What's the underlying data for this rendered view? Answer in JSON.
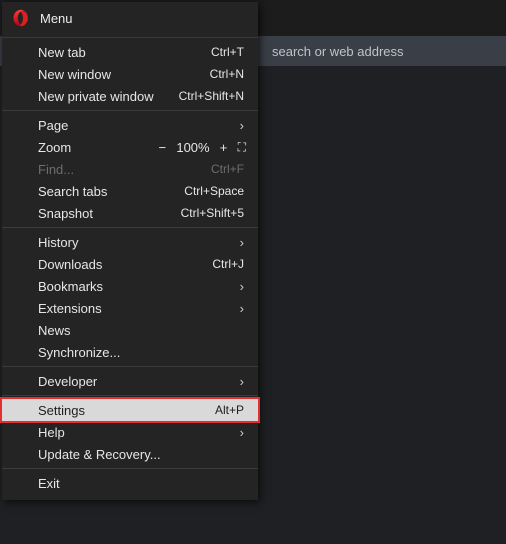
{
  "background": {
    "address_placeholder": "search or web address"
  },
  "menu": {
    "title": "Menu",
    "groups": [
      [
        {
          "label": "New tab",
          "shortcut": "Ctrl+T"
        },
        {
          "label": "New window",
          "shortcut": "Ctrl+N"
        },
        {
          "label": "New private window",
          "shortcut": "Ctrl+Shift+N"
        }
      ],
      [
        {
          "label": "Page",
          "submenu": true
        },
        {
          "label": "Zoom",
          "zoom": {
            "minus": "−",
            "value": "100%",
            "plus": "+",
            "fullscreen": "⛶"
          }
        },
        {
          "label": "Find...",
          "shortcut": "Ctrl+F",
          "disabled": true
        },
        {
          "label": "Search tabs",
          "shortcut": "Ctrl+Space"
        },
        {
          "label": "Snapshot",
          "shortcut": "Ctrl+Shift+5"
        }
      ],
      [
        {
          "label": "History",
          "submenu": true
        },
        {
          "label": "Downloads",
          "shortcut": "Ctrl+J"
        },
        {
          "label": "Bookmarks",
          "submenu": true
        },
        {
          "label": "Extensions",
          "submenu": true
        },
        {
          "label": "News"
        },
        {
          "label": "Synchronize..."
        }
      ],
      [
        {
          "label": "Developer",
          "submenu": true
        }
      ],
      [
        {
          "label": "Settings",
          "shortcut": "Alt+P",
          "selected": true
        },
        {
          "label": "Help",
          "submenu": true
        },
        {
          "label": "Update & Recovery..."
        }
      ],
      [
        {
          "label": "Exit"
        }
      ]
    ]
  }
}
